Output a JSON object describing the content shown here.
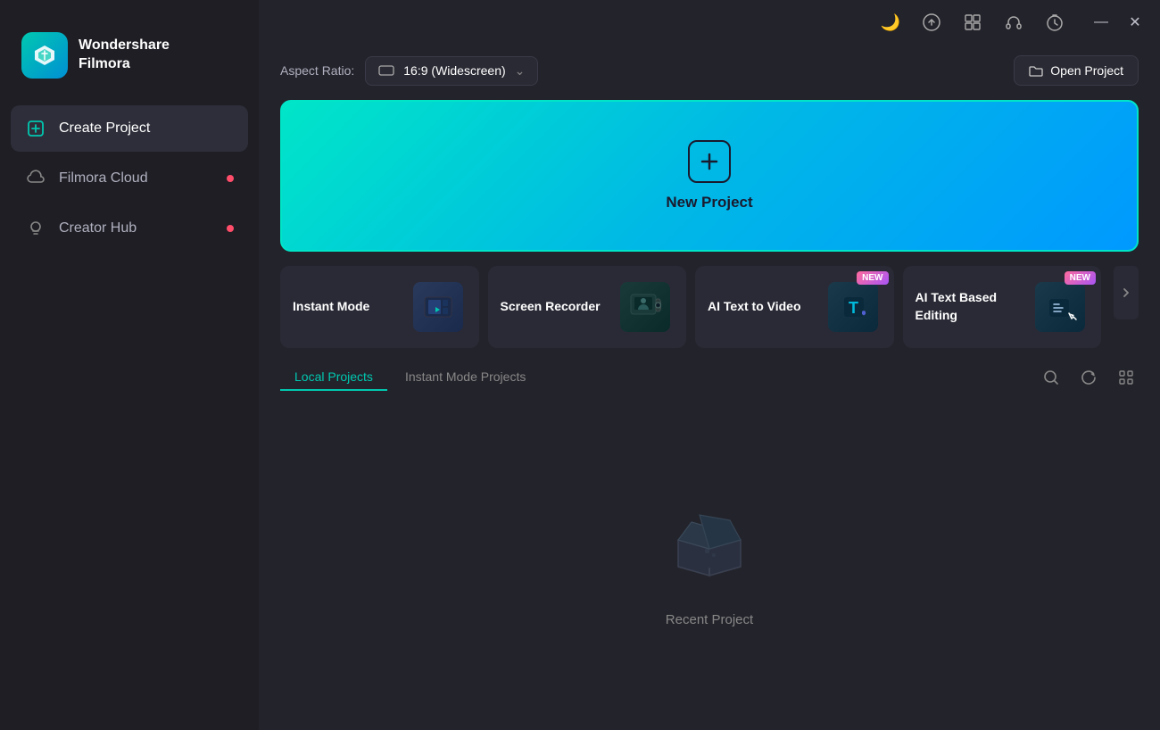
{
  "app": {
    "name": "Wondershare",
    "subtitle": "Filmora"
  },
  "sidebar": {
    "items": [
      {
        "id": "create-project",
        "label": "Create Project",
        "active": true,
        "dot": false
      },
      {
        "id": "filmora-cloud",
        "label": "Filmora Cloud",
        "active": false,
        "dot": true
      },
      {
        "id": "creator-hub",
        "label": "Creator Hub",
        "active": false,
        "dot": true
      }
    ]
  },
  "titlebar": {
    "icons": [
      "clock-icon",
      "upload-icon",
      "grid-icon",
      "headset-icon",
      "timer-icon"
    ]
  },
  "aspect_bar": {
    "label": "Aspect Ratio:",
    "value": "16:9 (Widescreen)",
    "open_project": "Open Project"
  },
  "new_project": {
    "label": "New Project"
  },
  "feature_cards": [
    {
      "id": "instant-mode",
      "label": "Instant Mode",
      "is_new": false
    },
    {
      "id": "screen-recorder",
      "label": "Screen Recorder",
      "is_new": false
    },
    {
      "id": "ai-text-to-video",
      "label": "AI Text to Video",
      "is_new": true
    },
    {
      "id": "ai-text-based-editing",
      "label": "AI Text Based Editing",
      "is_new": true
    }
  ],
  "projects": {
    "tabs": [
      {
        "id": "local-projects",
        "label": "Local Projects",
        "active": true
      },
      {
        "id": "instant-mode-projects",
        "label": "Instant Mode Projects",
        "active": false
      }
    ],
    "empty_label": "Recent Project"
  }
}
